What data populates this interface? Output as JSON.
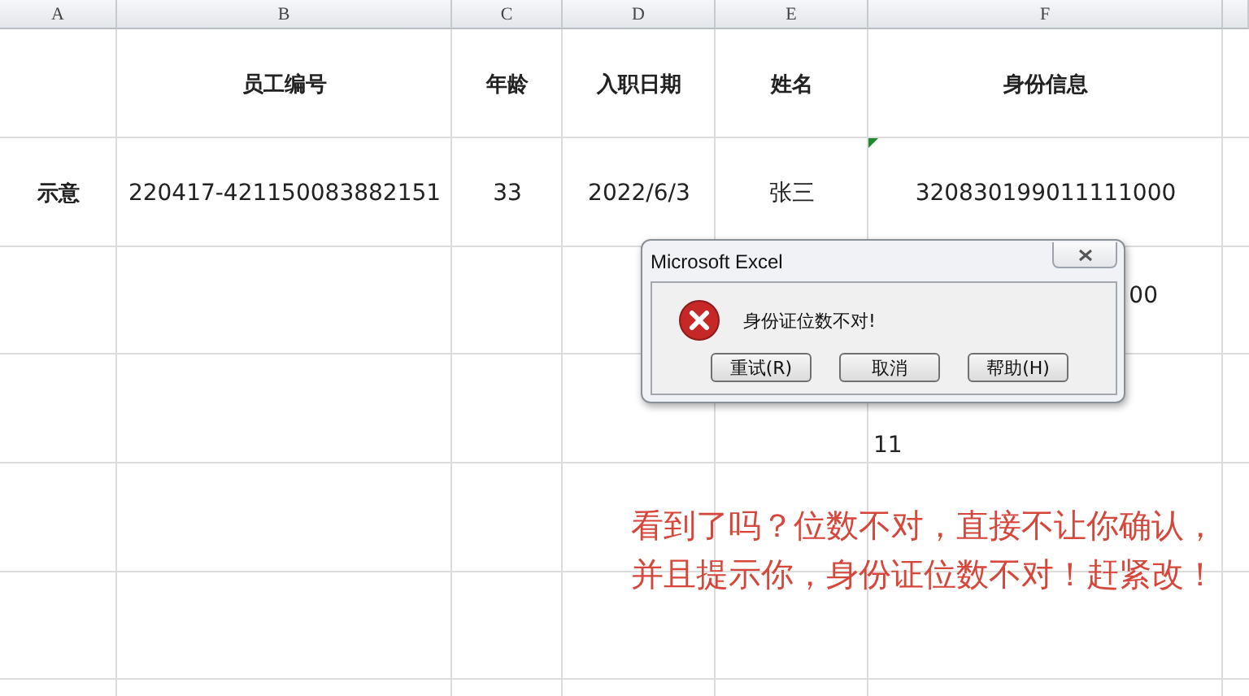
{
  "columns": [
    "A",
    "B",
    "C",
    "D",
    "E",
    "F"
  ],
  "rows": [
    {
      "column_2": {
        "text": "员工编号",
        "kind": "bold"
      },
      "column_3": {
        "text": "年龄",
        "kind": "bold"
      },
      "column_4": {
        "text": "入职日期",
        "kind": "bold"
      },
      "column_5": {
        "text": "姓名",
        "kind": "bold"
      },
      "column_6": {
        "text": "身份信息",
        "kind": "bold"
      }
    },
    {
      "column_1": {
        "text": "示意",
        "kind": "bold"
      },
      "column_2": {
        "text": "220417-421150083882151",
        "kind": "plain"
      },
      "column_3": {
        "text": "33",
        "kind": "plain"
      },
      "column_4": {
        "text": "2022/6/3",
        "kind": "plain"
      },
      "column_5": {
        "text": "张三",
        "kind": "plain"
      },
      "column_6": {
        "text": "320830199011111000",
        "kind": "plain",
        "error_flag": true
      }
    },
    {
      "column_6": {
        "text": "00",
        "kind": "cut"
      }
    },
    {
      "column_6": {
        "text": "11",
        "kind": "low-left"
      }
    }
  ],
  "dialog": {
    "title": "Microsoft Excel",
    "message": "身份证位数不对!",
    "buttons": [
      "重试(R)",
      "取消",
      "帮助(H)"
    ]
  },
  "annotation": "看到了吗？位数不对，直接不让你确认，并且提示你，身份证位数不对！赶紧改！"
}
